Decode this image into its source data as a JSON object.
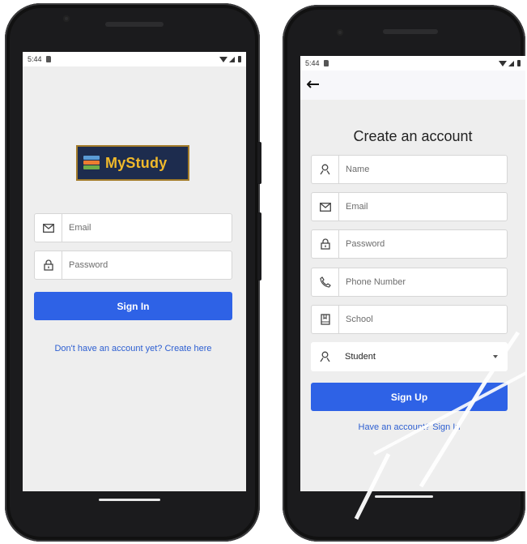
{
  "login_screen": {
    "status_time": "5:44",
    "logo_text": "MyStudy",
    "email_placeholder": "Email",
    "password_placeholder": "Password",
    "sign_in_label": "Sign In",
    "create_account_link": "Don't have an account yet? Create here"
  },
  "signup_screen": {
    "status_time": "5:44",
    "title": "Create an account",
    "name_placeholder": "Name",
    "email_placeholder": "Email",
    "password_placeholder": "Password",
    "phone_placeholder": "Phone Number",
    "school_placeholder": "School",
    "role_value": "Student",
    "sign_up_label": "Sign Up",
    "sign_in_link": "Have an account? Sign In"
  },
  "colors": {
    "primary": "#2e62e6",
    "link": "#2d5fd1",
    "screen_bg": "#eeeeee",
    "logo_bg": "#1d2c4e",
    "logo_text": "#f0b92b"
  },
  "icons": [
    "mail-icon",
    "lock-icon",
    "person-icon",
    "phone-icon",
    "book-icon",
    "back-arrow-icon",
    "dropdown-caret-icon"
  ]
}
